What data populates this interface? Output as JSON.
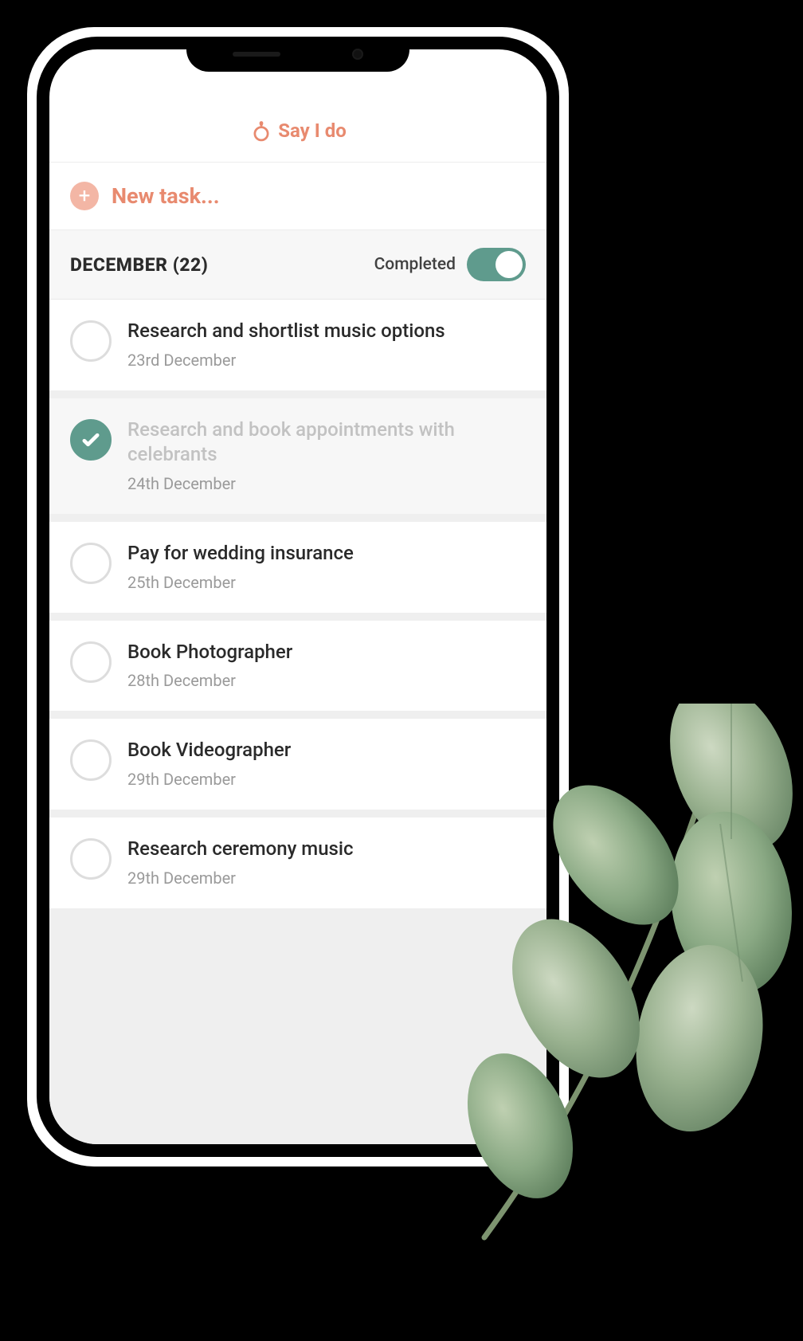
{
  "app": {
    "name": "Say I do"
  },
  "colors": {
    "accent": "#e88a6f",
    "teal": "#5f9b8d"
  },
  "new_task": {
    "plus": "+",
    "label": "New task..."
  },
  "section": {
    "title": "DECEMBER (22)",
    "completed_label": "Completed",
    "toggle_on": true
  },
  "tasks": [
    {
      "title": "Research and shortlist music options",
      "date": "23rd December",
      "completed": false
    },
    {
      "title": "Research and book appointments with celebrants",
      "date": "24th December",
      "completed": true
    },
    {
      "title": "Pay for wedding insurance",
      "date": "25th December",
      "completed": false
    },
    {
      "title": "Book Photographer",
      "date": "28th December",
      "completed": false
    },
    {
      "title": "Book Videographer",
      "date": "29th December",
      "completed": false
    },
    {
      "title": "Research ceremony music",
      "date": "29th December",
      "completed": false
    }
  ]
}
